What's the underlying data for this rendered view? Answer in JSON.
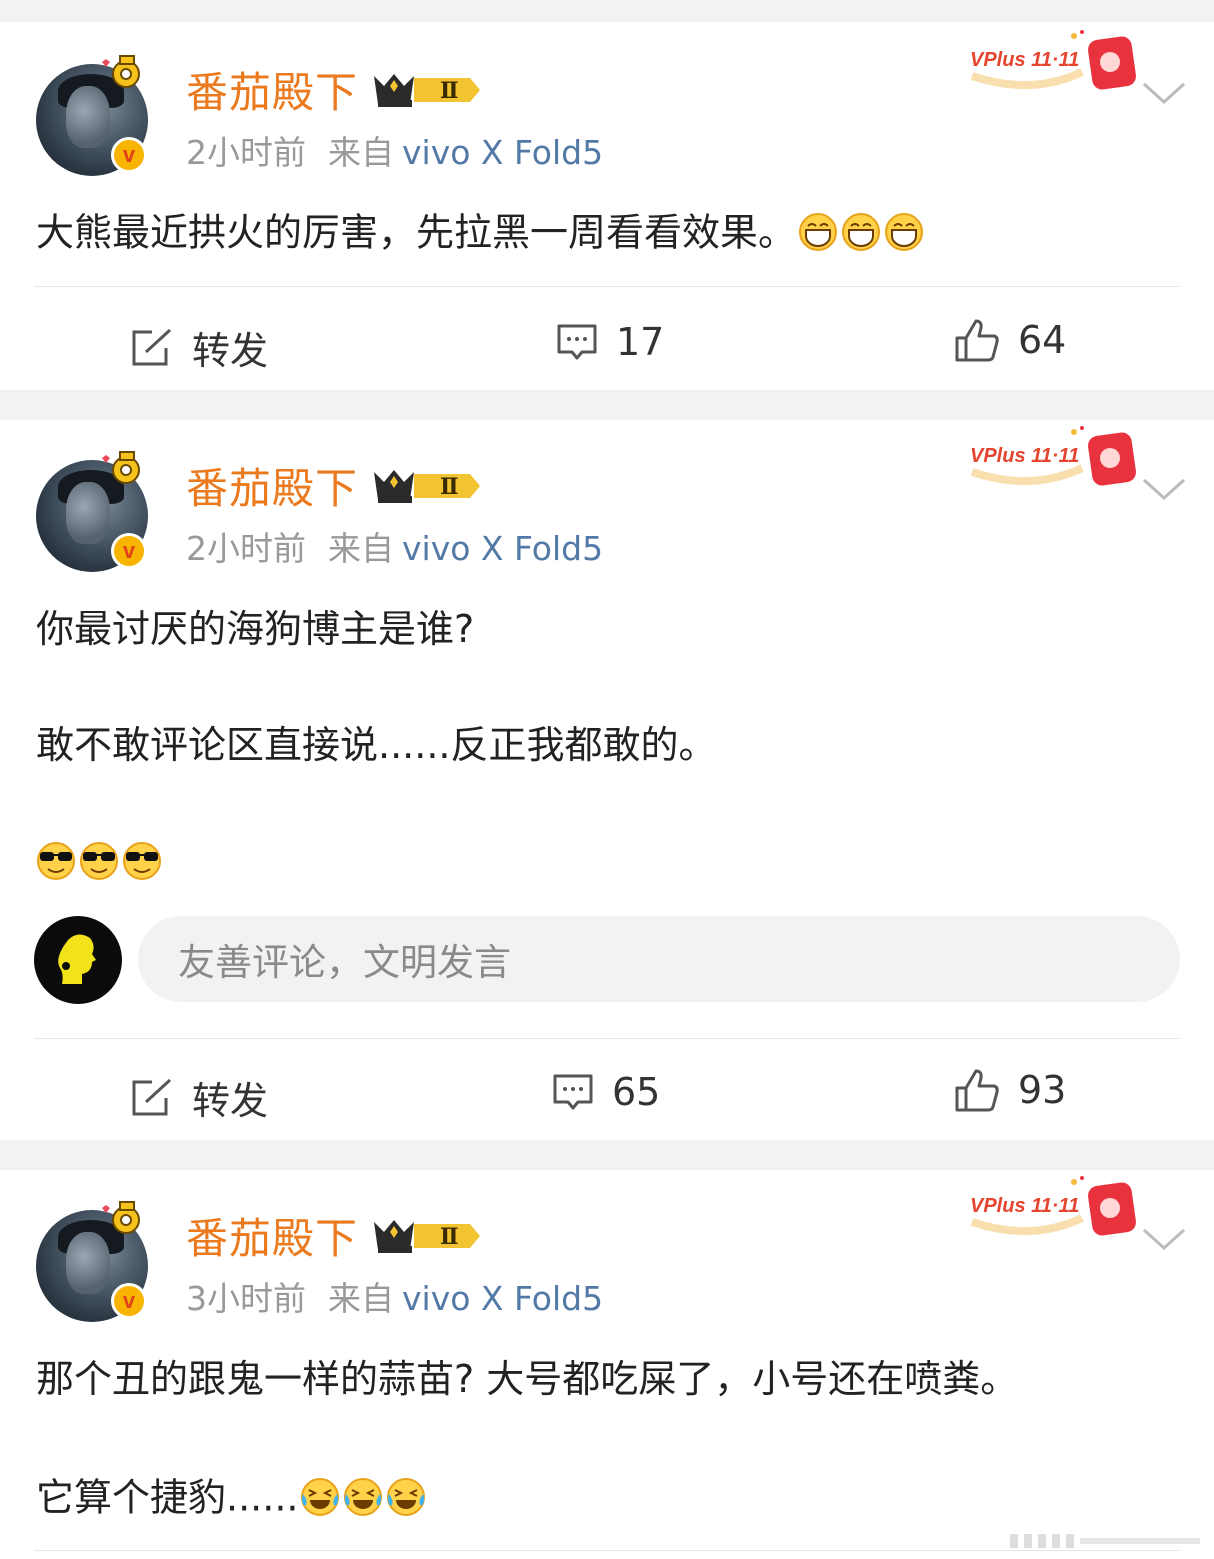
{
  "posts": [
    {
      "author": "番茄殿下",
      "level_badge": "Ⅱ",
      "time": "2小时前",
      "source_prefix": "来自",
      "device": "vivo X Fold5",
      "promo": "VPlus 11·11",
      "lines": [
        "大熊最近拱火的厉害，先拉黑一周看看效果。"
      ],
      "emoji_line_index": 0,
      "emoji_type": "grin",
      "emoji_count": 3,
      "repost_label": "转发",
      "comment_count": "17",
      "like_count": "64"
    },
    {
      "author": "番茄殿下",
      "level_badge": "Ⅱ",
      "time": "2小时前",
      "source_prefix": "来自",
      "device": "vivo X Fold5",
      "promo": "VPlus 11·11",
      "lines": [
        "你最讨厌的海狗博主是谁?",
        "敢不敢评论区直接说......反正我都敢的。"
      ],
      "emoji_type": "cool",
      "emoji_count": 3,
      "comment_placeholder": "友善评论，文明发言",
      "repost_label": "转发",
      "comment_count": "65",
      "like_count": "93"
    },
    {
      "author": "番茄殿下",
      "level_badge": "Ⅱ",
      "time": "3小时前",
      "source_prefix": "来自",
      "device": "vivo X Fold5",
      "promo": "VPlus 11·11",
      "lines": [
        "那个丑的跟鬼一样的蒜苗? 大号都吃屎了，小号还在喷粪。",
        "它算个捷豹......"
      ],
      "emoji_type": "laugh-cry",
      "emoji_count": 3
    }
  ],
  "colors": {
    "author_name": "#eb7a1e",
    "device_link": "#537aa6",
    "meta_gray": "#999999",
    "page_bg": "#f2f2f2",
    "vip_badge": "#f8b400"
  }
}
